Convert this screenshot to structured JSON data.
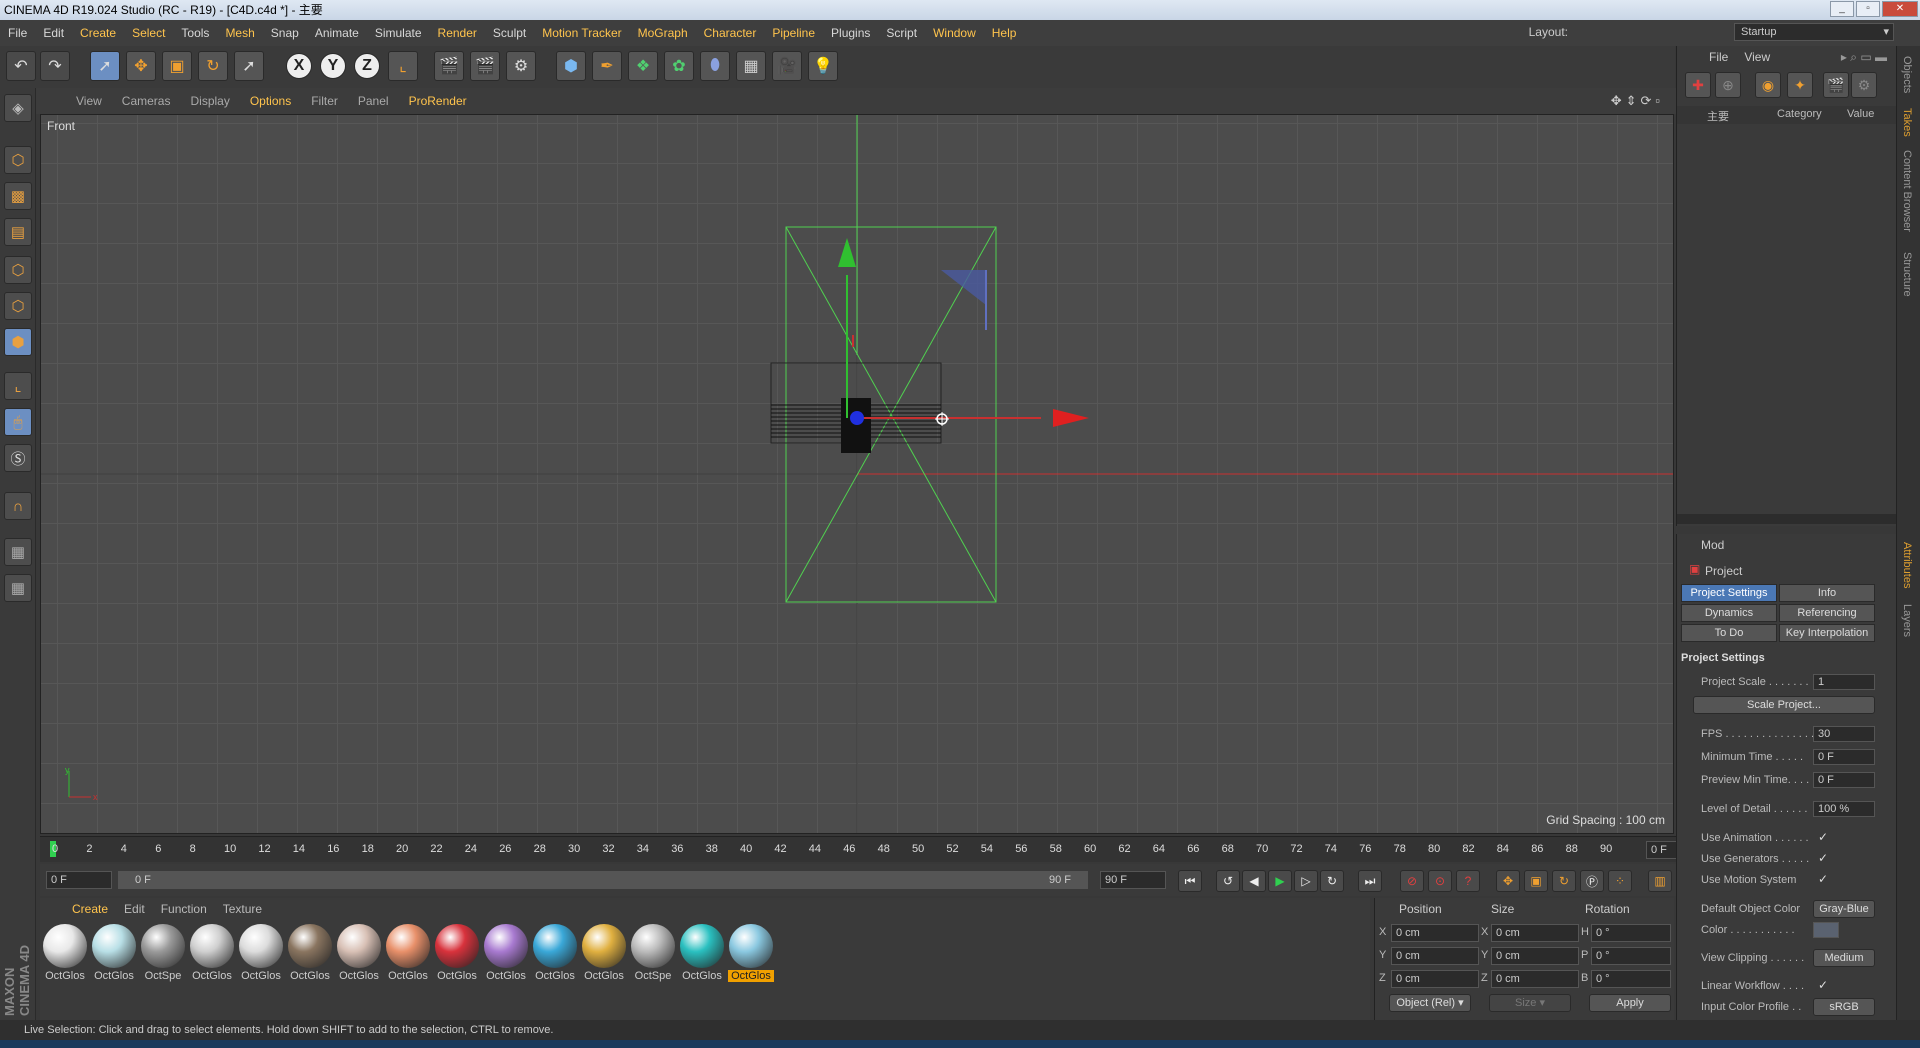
{
  "window": {
    "title": "CINEMA 4D R19.024 Studio (RC - R19) - [C4D.c4d *] - 主要"
  },
  "menu": {
    "items": [
      "File",
      "Edit",
      "Create",
      "Select",
      "Tools",
      "Mesh",
      "Snap",
      "Animate",
      "Simulate",
      "Render",
      "Sculpt",
      "Motion Tracker",
      "MoGraph",
      "Character",
      "Pipeline",
      "Plugins",
      "Script",
      "Window",
      "Help"
    ],
    "layout_label": "Layout:",
    "layout_value": "Startup"
  },
  "toolbar": {
    "axes": [
      "X",
      "Y",
      "Z"
    ]
  },
  "viewport": {
    "menu": [
      "View",
      "Cameras",
      "Display",
      "Options",
      "Filter",
      "Panel",
      "ProRender"
    ],
    "active_menu": "Options",
    "name": "Front",
    "grid_spacing": "Grid Spacing : 100 cm",
    "axis_y": "y",
    "axis_x": "x"
  },
  "timeline": {
    "ticks": [
      "0",
      "2",
      "4",
      "6",
      "8",
      "10",
      "12",
      "14",
      "16",
      "18",
      "20",
      "22",
      "24",
      "26",
      "28",
      "30",
      "32",
      "34",
      "36",
      "38",
      "40",
      "42",
      "44",
      "46",
      "48",
      "50",
      "52",
      "54",
      "56",
      "58",
      "60",
      "62",
      "64",
      "66",
      "68",
      "70",
      "72",
      "74",
      "76",
      "78",
      "80",
      "82",
      "84",
      "86",
      "88",
      "90"
    ],
    "current_frame": "0 F",
    "start": "0 F",
    "range_start": "0 F",
    "range_end": "90 F",
    "end": "90 F"
  },
  "materials": {
    "menu": [
      "Create",
      "Edit",
      "Function",
      "Texture"
    ],
    "items": [
      {
        "name": "OctGlos",
        "color": "#e8e8e8"
      },
      {
        "name": "OctGlos",
        "color": "#b8dfe6"
      },
      {
        "name": "OctSpe",
        "color": "#9a9a9a"
      },
      {
        "name": "OctGlos",
        "color": "#cfcfcf"
      },
      {
        "name": "OctGlos",
        "color": "#dcdcdc"
      },
      {
        "name": "OctGlos",
        "color": "#8a7560"
      },
      {
        "name": "OctGlos",
        "color": "#d8c0b5"
      },
      {
        "name": "OctGlos",
        "color": "#e8906a"
      },
      {
        "name": "OctGlos",
        "color": "#d8323c"
      },
      {
        "name": "OctGlos",
        "color": "#a87ad0"
      },
      {
        "name": "OctGlos",
        "color": "#3aa8d8"
      },
      {
        "name": "OctGlos",
        "color": "#e0b040"
      },
      {
        "name": "OctSpe",
        "color": "#bbbbbb"
      },
      {
        "name": "OctGlos",
        "color": "#2ac0c0"
      },
      {
        "name": "OctGlos",
        "color": "#8ac8e0",
        "selected": true
      }
    ]
  },
  "coords": {
    "headers": [
      "Position",
      "Size",
      "Rotation"
    ],
    "rows": [
      {
        "a": "X",
        "p": "0 cm",
        "b": "X",
        "s": "0 cm",
        "c": "H",
        "r": "0 °"
      },
      {
        "a": "Y",
        "p": "0 cm",
        "b": "Y",
        "s": "0 cm",
        "c": "P",
        "r": "0 °"
      },
      {
        "a": "Z",
        "p": "0 cm",
        "b": "Z",
        "s": "0 cm",
        "c": "B",
        "r": "0 °"
      }
    ],
    "mode": "Object (Rel)",
    "size_mode": "Size",
    "apply": "Apply"
  },
  "status": "Live Selection: Click and drag to select elements. Hold down SHIFT to add to the selection, CTRL to remove.",
  "objects": {
    "menu": [
      "File",
      "View"
    ],
    "col_name": "主要",
    "col_category": "Category",
    "col_value": "Value"
  },
  "attributes": {
    "mode": "Mod",
    "title": "Project",
    "tabs": [
      "Project Settings",
      "Info",
      "Dynamics",
      "Referencing",
      "To Do",
      "Key Interpolation"
    ],
    "section": "Project Settings",
    "scale_button": "Scale Project...",
    "fields": [
      {
        "label": "Project Scale . . . . . . .",
        "value": "1"
      },
      {
        "label": "FPS . . . . . . . . . . . . . . .",
        "value": "30"
      },
      {
        "label": "Minimum Time . . . . .",
        "value": "0 F"
      },
      {
        "label": "Preview Min Time. . . .",
        "value": "0 F"
      },
      {
        "label": "Level of Detail . . . . . .",
        "value": "100 %"
      }
    ],
    "checks": [
      {
        "label": "Use Animation . . . . . .",
        "value": "✓"
      },
      {
        "label": "Use Generators . . . . .",
        "value": "✓"
      },
      {
        "label": "Use Motion System",
        "value": "✓"
      }
    ],
    "default_color_label": "Default Object Color",
    "default_color_value": "Gray-Blue",
    "color_label": "Color . . . . . . . . . . .",
    "clipping_label": "View Clipping . . . . . .",
    "clipping_value": "Medium",
    "linear_label": "Linear Workflow . . . .",
    "linear_value": "✓",
    "input_profile_label": "Input Color Profile . .",
    "input_profile_value": "sRGB"
  },
  "side_tabs": [
    "Objects",
    "Takes",
    "Content Browser",
    "Structure"
  ],
  "side_tabs_bottom": [
    "Attributes",
    "Layers"
  ]
}
